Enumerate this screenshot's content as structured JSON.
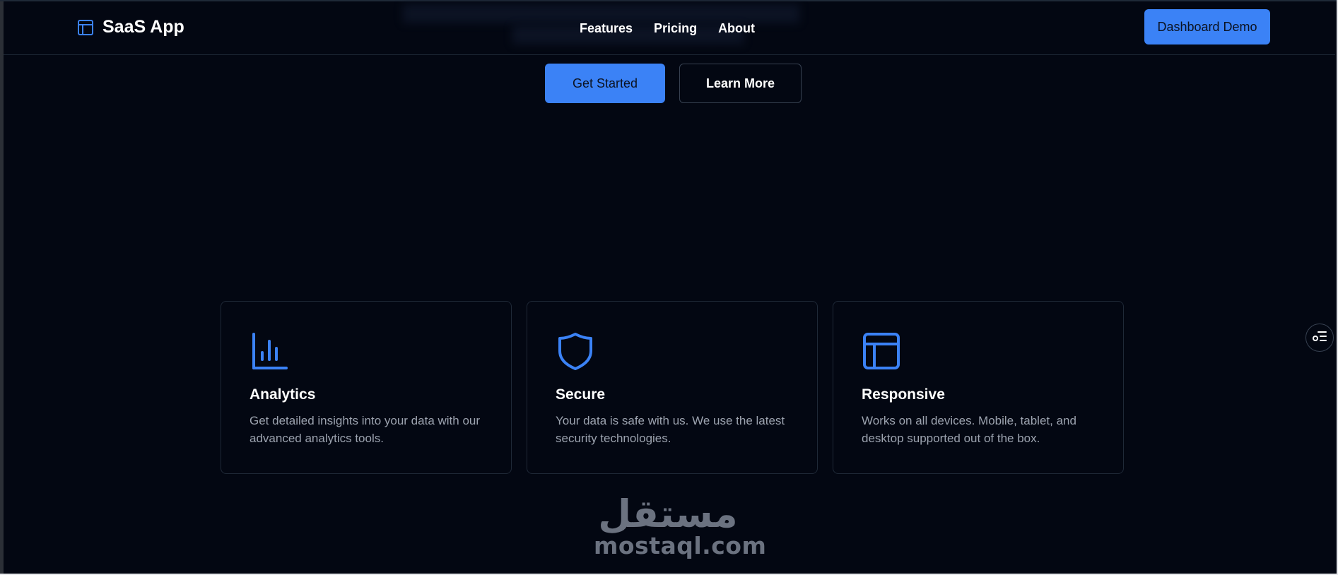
{
  "header": {
    "app_name": "SaaS App",
    "nav": [
      "Features",
      "Pricing",
      "About"
    ],
    "demo_button": "Dashboard Demo"
  },
  "hero": {
    "primary_button": "Get Started",
    "secondary_button": "Learn More"
  },
  "features": [
    {
      "icon": "bar-chart-icon",
      "title": "Analytics",
      "description": "Get detailed insights into your data with our advanced analytics tools."
    },
    {
      "icon": "shield-icon",
      "title": "Secure",
      "description": "Your data is safe with us. We use the latest security technologies."
    },
    {
      "icon": "layout-icon",
      "title": "Responsive",
      "description": "Works on all devices. Mobile, tablet, and desktop supported out of the box."
    }
  ],
  "watermark": {
    "arabic": "مستقل",
    "latin": "mostaql.com"
  },
  "colors": {
    "background": "#030712",
    "accent": "#3b82f6",
    "border": "#1f2937",
    "muted_text": "#9ca3af"
  }
}
